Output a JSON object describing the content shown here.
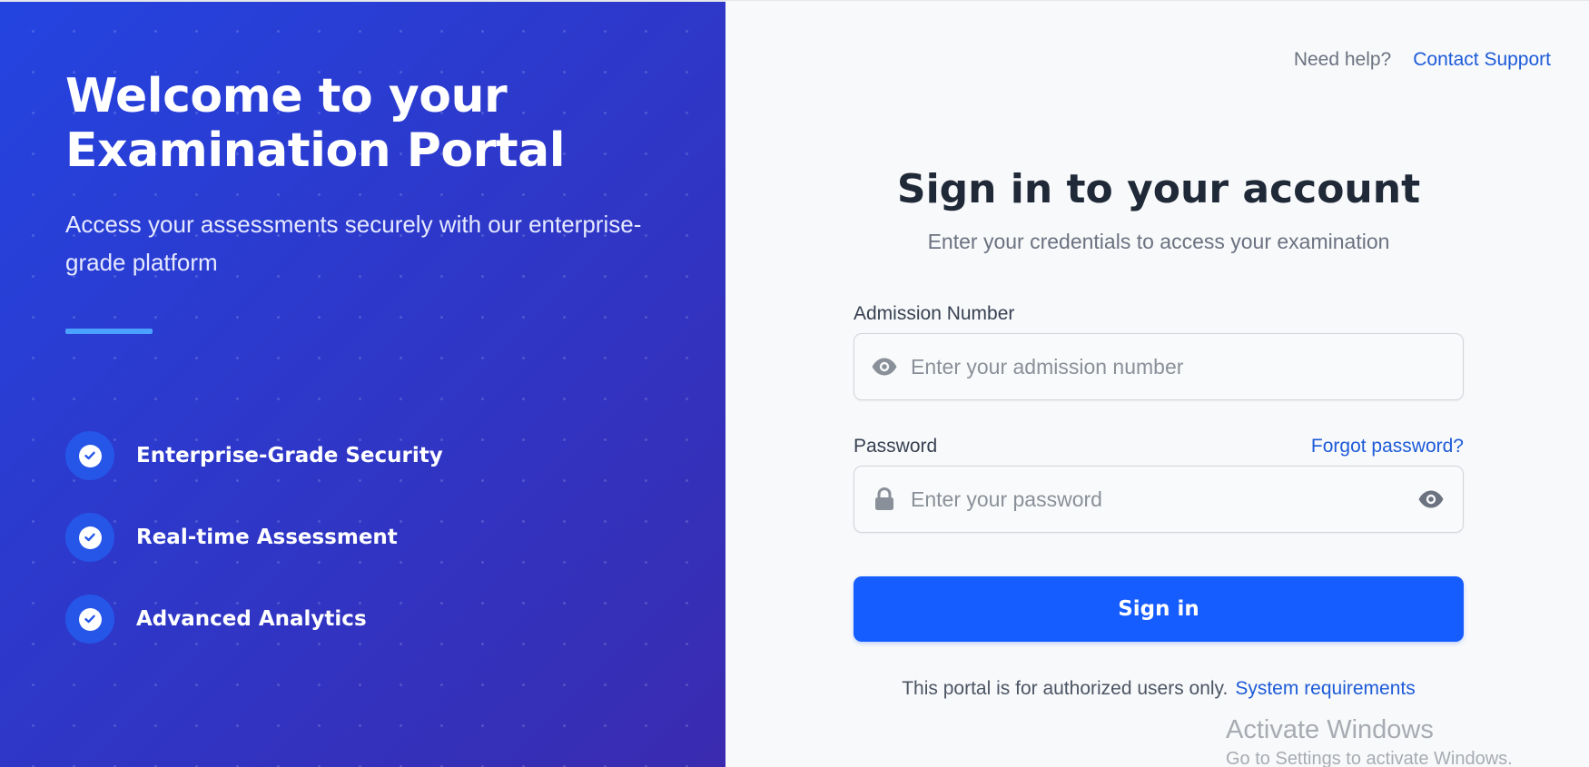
{
  "hero": {
    "title": "Welcome to your Examination Portal",
    "subtitle": "Access your assessments securely with our enterprise-grade platform",
    "features": [
      {
        "label": "Enterprise-Grade Security",
        "icon": "check-circle-icon"
      },
      {
        "label": "Real-time Assessment",
        "icon": "check-circle-icon"
      },
      {
        "label": "Advanced Analytics",
        "icon": "check-circle-icon"
      }
    ]
  },
  "help": {
    "text": "Need help?",
    "link": "Contact Support"
  },
  "form": {
    "title": "Sign in to your account",
    "subtitle": "Enter your credentials to access your examination",
    "admission": {
      "label": "Admission Number",
      "placeholder": "Enter your admission number",
      "value": "",
      "icon": "eye-icon"
    },
    "password": {
      "label": "Password",
      "placeholder": "Enter your password",
      "value": "",
      "icon": "lock-icon",
      "toggle_icon": "eye-icon",
      "forgot_link": "Forgot password?"
    },
    "submit_label": "Sign in",
    "footer_text": "This portal is for authorized users only.",
    "footer_link": "System requirements"
  },
  "watermark": {
    "title": "Activate Windows",
    "subtitle": "Go to Settings to activate Windows."
  },
  "colors": {
    "hero_gradient_start": "#2444e0",
    "hero_gradient_end": "#3a2bb0",
    "accent_blue": "#165dff",
    "link_blue": "#1d5bd8",
    "divider_blue": "#4aa1ff",
    "panel_bg": "#f8f9fb"
  }
}
